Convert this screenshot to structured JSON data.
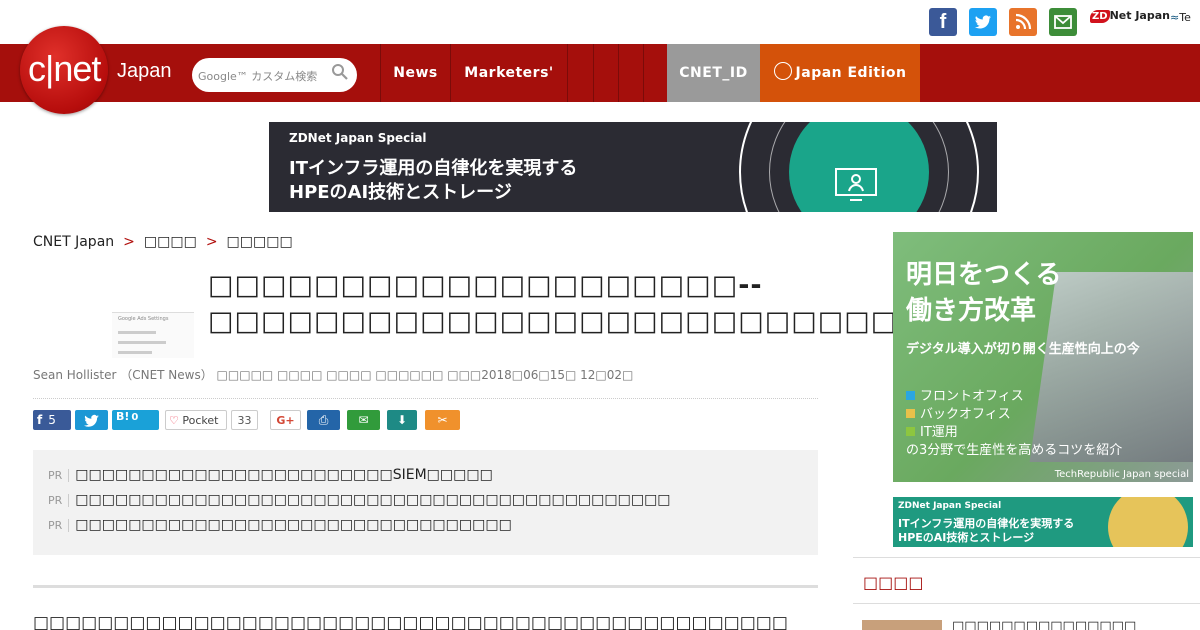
{
  "social": {
    "facebook_glyph": "f",
    "twitter_glyph": "t",
    "rss_glyph": "",
    "mail_glyph": "",
    "zdnet_logo": "ZDNet Japan",
    "zdnet_mark": "ZD",
    "zdnet_rest": "Net Japan",
    "techrepublic_logo": "Te"
  },
  "header": {
    "logo_text": "c|net",
    "logo_sub": "Japan",
    "search_placeholder": "Google™ カスタム検索",
    "nav": [
      "News",
      "Marketers'"
    ],
    "cnet_id": "CNET_ID",
    "edition": "Japan Edition"
  },
  "banner": {
    "label": "ZDNet Japan Special",
    "line1": "ITインフラ運用の自律化を実現する",
    "line2": "HPEのAI技術とストレージ"
  },
  "breadcrumb": [
    "CNET Japan",
    "□□□□",
    "□□□□□"
  ],
  "breadcrumb_sep": ">",
  "article": {
    "title": "□□□□□□□□□□□□□□□□□□□□--□□□□□□□□□□□□□□□□□□□□□□□□□□",
    "thumb_caption": "Google Ads Settings",
    "byline": "Sean Hollister （CNET News） □□□□□ □□□□ □□□□ □□□□□□ □□□2018□06□15□ 12□02□",
    "body_start": "□□□□□□□□□□□□□□□□□□□□□□□□□□□□□□□□□□□□□□□□□□□□□□□"
  },
  "share": {
    "facebook_count": "5",
    "hatena_label": "B!",
    "hatena_count": "0",
    "pocket_label": "Pocket",
    "pocket_count": "33",
    "gplus_label": "G+",
    "print_glyph": "⎙",
    "mail_glyph": "✉",
    "save_glyph": "⬇",
    "clip_glyph": "✂"
  },
  "pr": {
    "tag": "PR",
    "items": [
      "□□□□□□□□□□□□□□□□□□□□□□□□SIEM□□□□□",
      "□□□□□□□□□□□□□□□□□□□□□□□□□□□□□□□□□□□□□□□□□□□□□",
      "□□□□□□□□□□□□□□□□□□□□□□□□□□□□□□□□□"
    ]
  },
  "sidebar": {
    "ad1_title_1": "明日をつくる",
    "ad1_title_2": "働き方改革",
    "ad1_sub": "デジタル導入が切り開く生産性向上の今",
    "ad1_items": [
      "フロントオフィス",
      "バックオフィス",
      "IT運用"
    ],
    "ad1_item_colors": [
      "#2aa6e0",
      "#e8c14a",
      "#8dc63f"
    ],
    "ad1_tail": "の3分野で生産性を高めるコツを紹介",
    "ad1_footer": "TechRepublic Japan special",
    "ad2_label": "ZDNet Japan Special",
    "ad2_line1": "ITインフラ運用の自律化を実現する",
    "ad2_line2": "HPEのAI技術とストレージ",
    "section_heading": "□□□□",
    "first_item": "□□□□□□□□□□□□□□□"
  },
  "colors": {
    "header_red": "#a50f0c",
    "edition_orange": "#d4520a",
    "cnetid_gray": "#9a9a9a",
    "accent_red": "#b10f0c"
  }
}
